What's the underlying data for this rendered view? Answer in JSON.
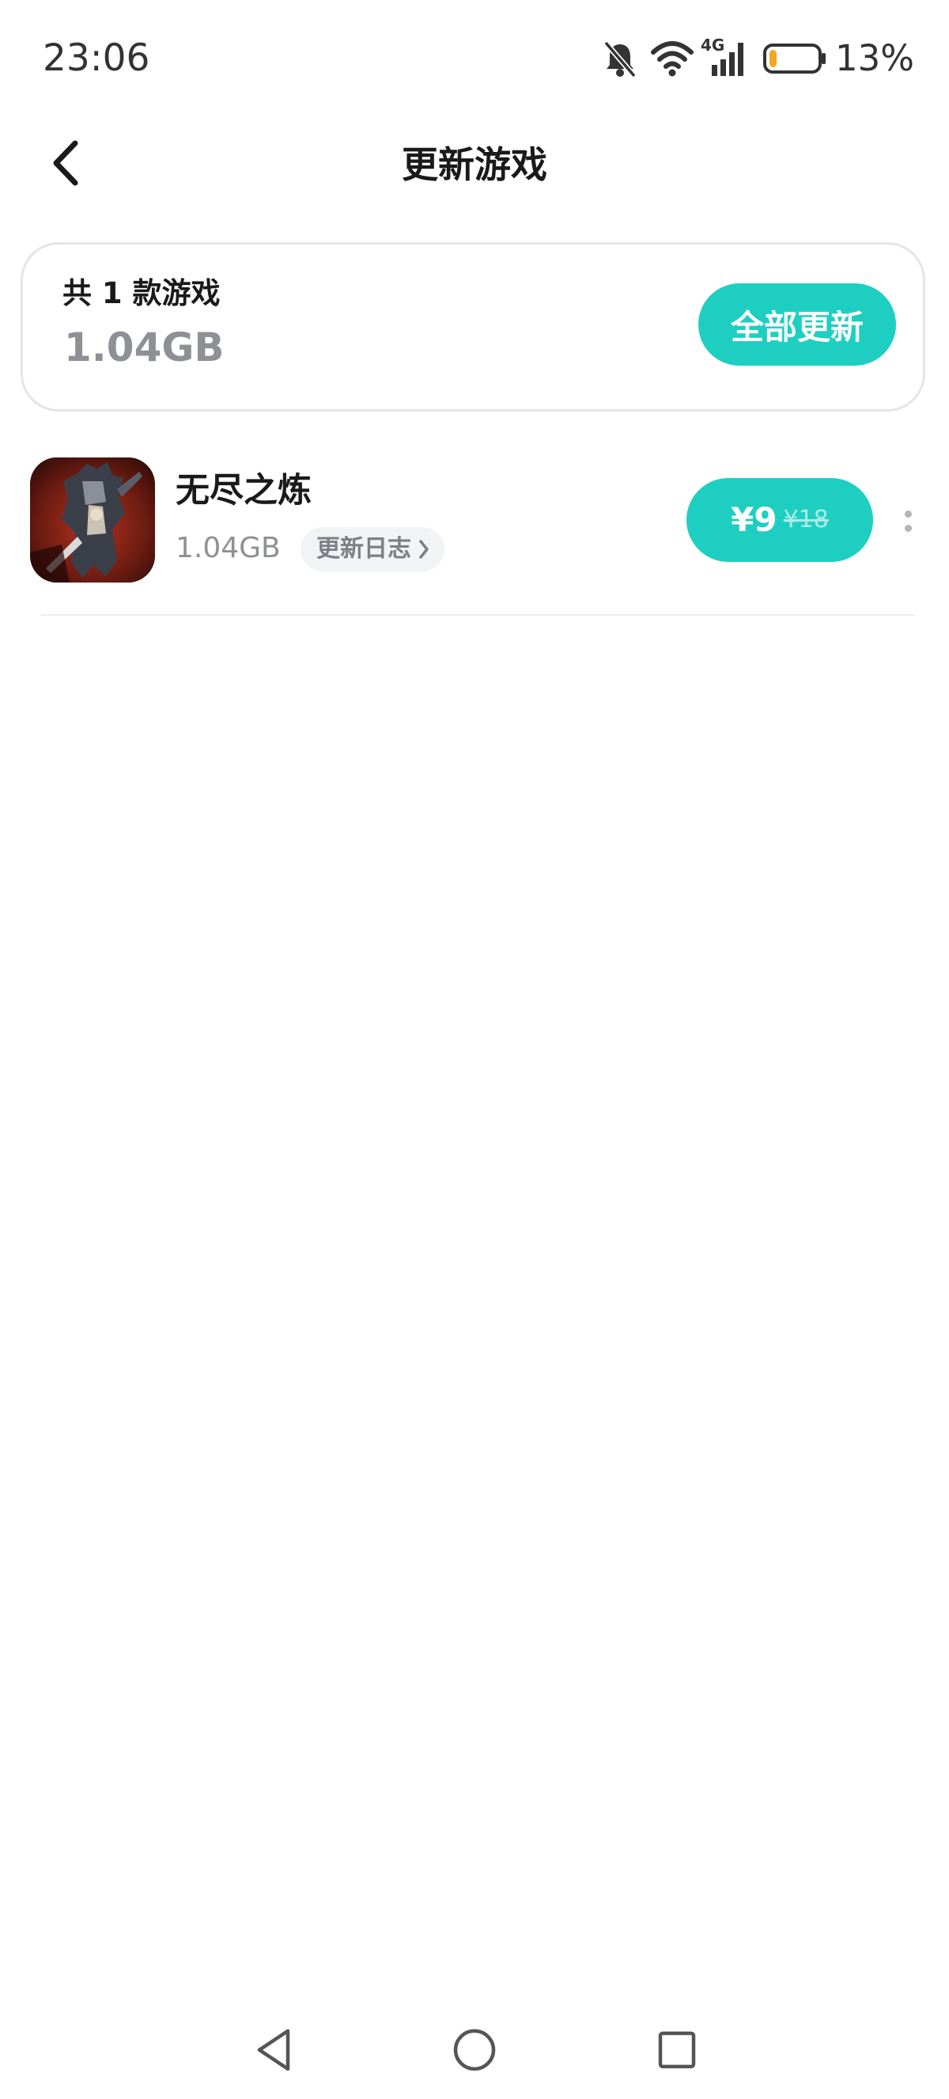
{
  "status_bar": {
    "time": "23:06",
    "network_label": "4G",
    "battery_percent": "13%",
    "battery_level": 0.13,
    "icons": [
      "bell-off-icon",
      "wifi-icon",
      "signal-icon",
      "battery-icon"
    ]
  },
  "header": {
    "title": "更新游戏",
    "back_icon": "chevron-left-icon"
  },
  "summary": {
    "count_text": "共 1 款游戏",
    "total_size": "1.04GB",
    "update_all_label": "全部更新"
  },
  "games": [
    {
      "name": "无尽之炼",
      "size": "1.04GB",
      "changelog_label": "更新日志",
      "price_current": "¥9",
      "price_original": "¥18",
      "icon": "game-icon-knight"
    }
  ],
  "colors": {
    "accent": "#1ecfc1",
    "muted_text": "#8e9096",
    "battery_low": "#f5a623"
  },
  "nav_bar": {
    "icons": [
      "back-triangle-icon",
      "home-circle-icon",
      "recents-square-icon"
    ]
  }
}
